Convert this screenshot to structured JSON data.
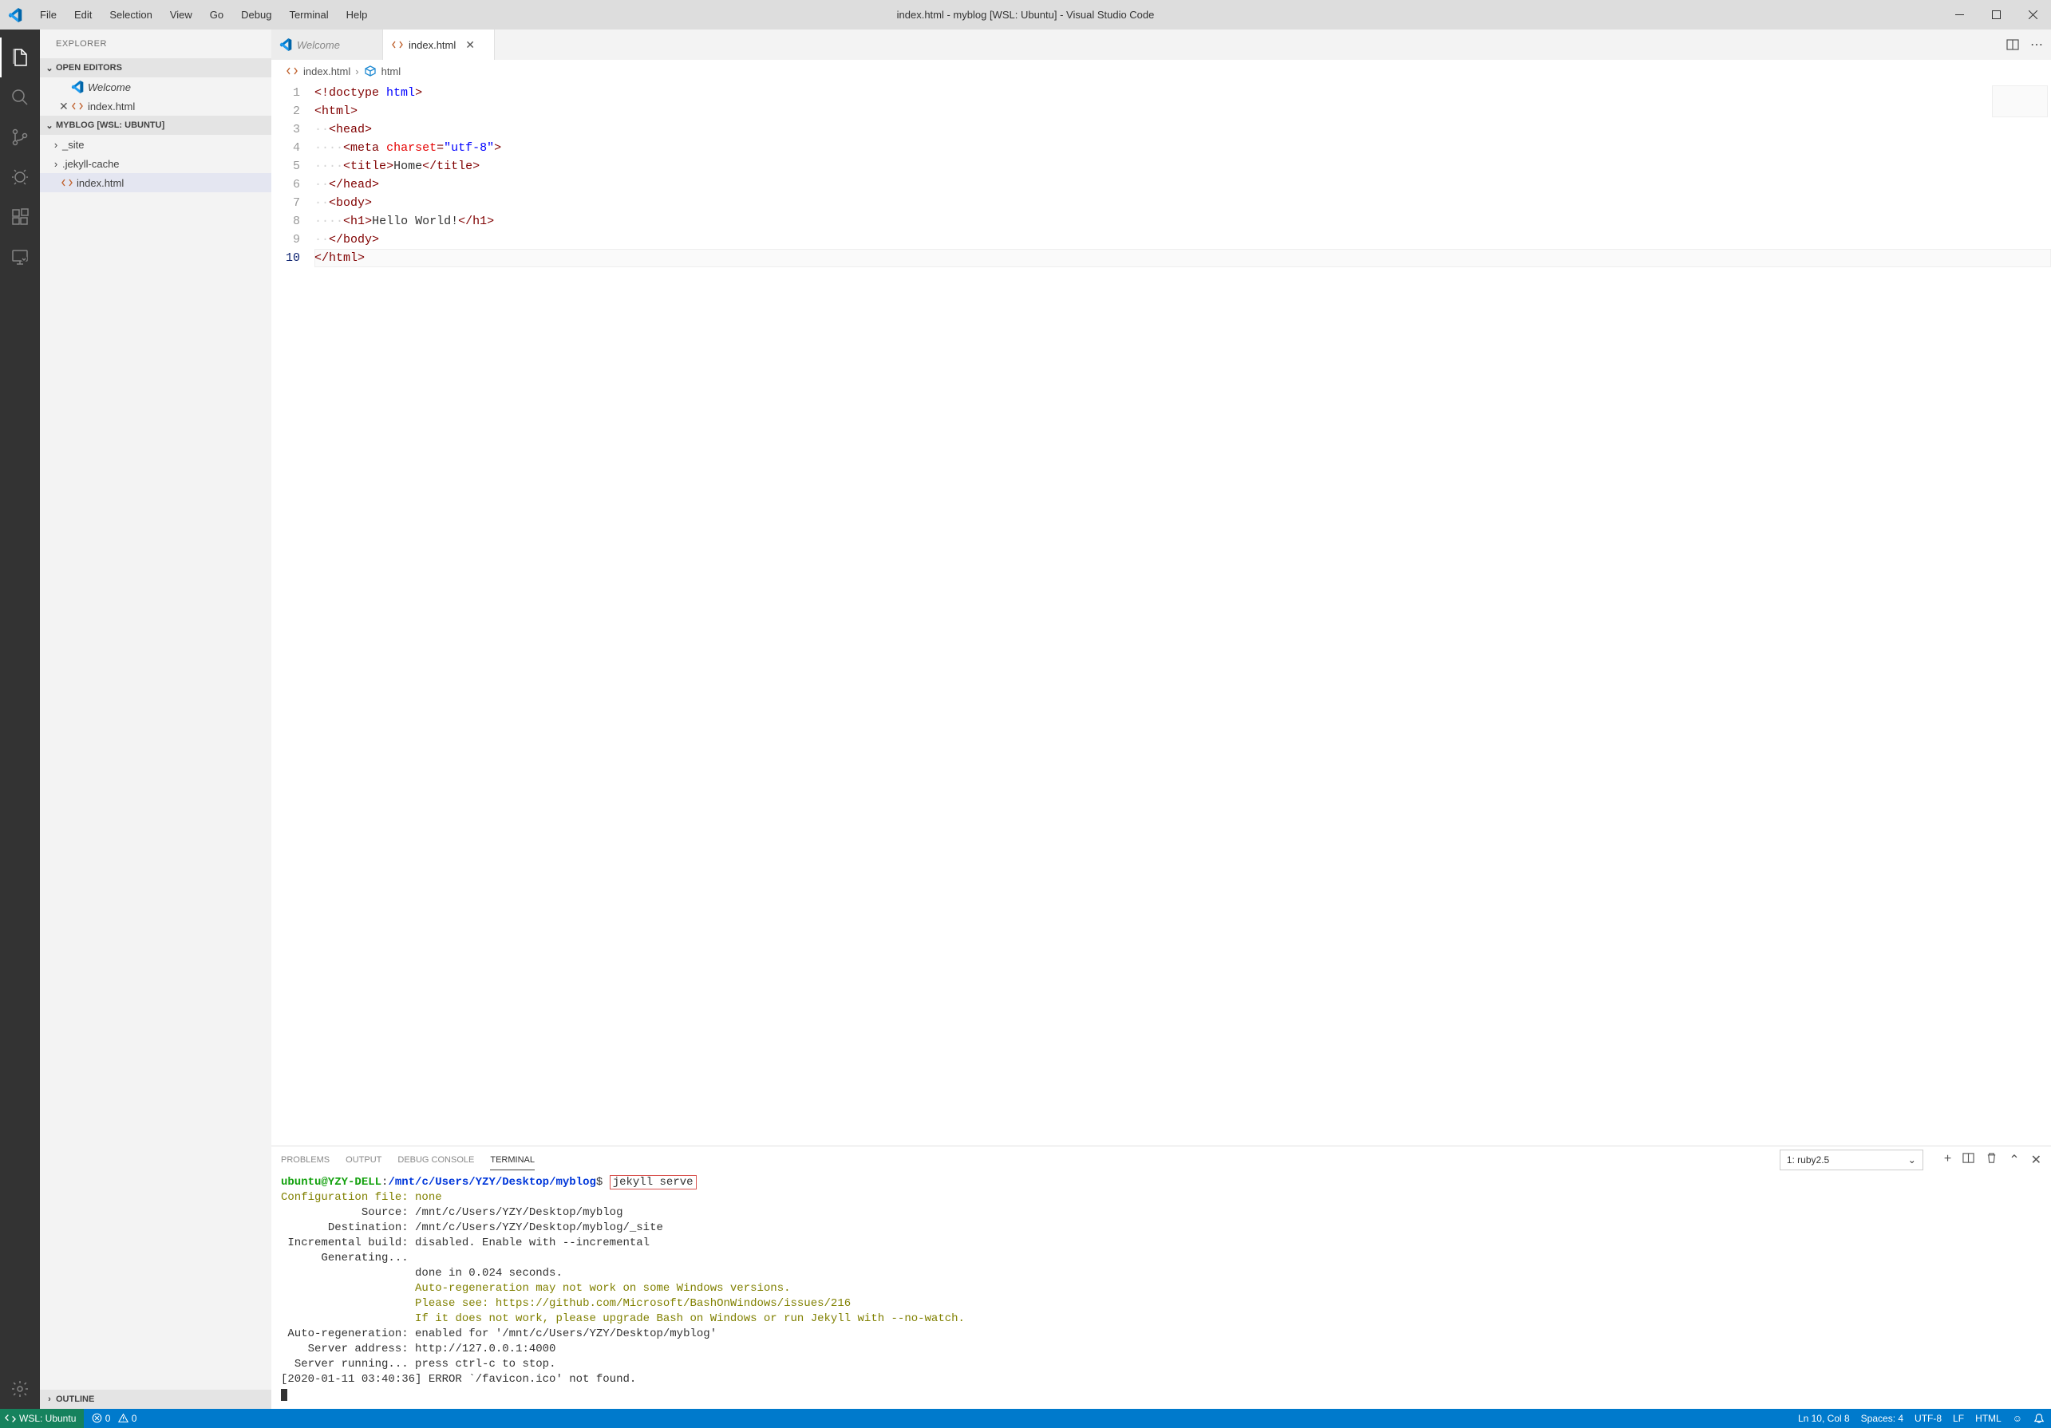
{
  "window": {
    "title": "index.html - myblog [WSL: Ubuntu] - Visual Studio Code"
  },
  "menu": [
    "File",
    "Edit",
    "Selection",
    "View",
    "Go",
    "Debug",
    "Terminal",
    "Help"
  ],
  "activity": {
    "items": [
      "explorer",
      "search",
      "scm",
      "debug",
      "extensions",
      "remote"
    ],
    "bottom": "settings"
  },
  "sidebar": {
    "header": "EXPLORER",
    "open_editors_label": "OPEN EDITORS",
    "open_editors": [
      {
        "label": "Welcome",
        "icon": "vscode",
        "italic": true,
        "closable": false
      },
      {
        "label": "index.html",
        "icon": "html",
        "italic": false,
        "closable": true
      }
    ],
    "project_label": "MYBLOG [WSL: UBUNTU]",
    "tree": [
      {
        "label": "_site",
        "type": "folder"
      },
      {
        "label": ".jekyll-cache",
        "type": "folder"
      },
      {
        "label": "index.html",
        "type": "file",
        "selected": true
      }
    ],
    "outline_label": "OUTLINE"
  },
  "tabs": {
    "items": [
      {
        "label": "Welcome",
        "icon": "vscode",
        "italic": true,
        "closable": false,
        "active": false
      },
      {
        "label": "index.html",
        "icon": "html",
        "italic": false,
        "closable": true,
        "active": true
      }
    ]
  },
  "breadcrumbs": {
    "file": "index.html",
    "symbol": "html"
  },
  "editor": {
    "lines": [
      {
        "n": 1,
        "segments": [
          {
            "c": "tok-punct",
            "t": "<!"
          },
          {
            "c": "tok-decl",
            "t": "doctype"
          },
          {
            "c": "",
            "t": " "
          },
          {
            "c": "tok-name",
            "t": "html"
          },
          {
            "c": "tok-punct",
            "t": ">"
          }
        ],
        "indent": 0
      },
      {
        "n": 2,
        "segments": [
          {
            "c": "tok-punct",
            "t": "<"
          },
          {
            "c": "tok-tag",
            "t": "html"
          },
          {
            "c": "tok-punct",
            "t": ">"
          }
        ],
        "indent": 0
      },
      {
        "n": 3,
        "segments": [
          {
            "c": "tok-punct",
            "t": "<"
          },
          {
            "c": "tok-tag",
            "t": "head"
          },
          {
            "c": "tok-punct",
            "t": ">"
          }
        ],
        "indent": 1
      },
      {
        "n": 4,
        "segments": [
          {
            "c": "tok-punct",
            "t": "<"
          },
          {
            "c": "tok-tag",
            "t": "meta"
          },
          {
            "c": "",
            "t": " "
          },
          {
            "c": "tok-attr",
            "t": "charset"
          },
          {
            "c": "tok-punct",
            "t": "="
          },
          {
            "c": "tok-str",
            "t": "\"utf-8\""
          },
          {
            "c": "tok-punct",
            "t": ">"
          }
        ],
        "indent": 2
      },
      {
        "n": 5,
        "segments": [
          {
            "c": "tok-punct",
            "t": "<"
          },
          {
            "c": "tok-tag",
            "t": "title"
          },
          {
            "c": "tok-punct",
            "t": ">"
          },
          {
            "c": "tok-text",
            "t": "Home"
          },
          {
            "c": "tok-punct",
            "t": "</"
          },
          {
            "c": "tok-tag",
            "t": "title"
          },
          {
            "c": "tok-punct",
            "t": ">"
          }
        ],
        "indent": 2
      },
      {
        "n": 6,
        "segments": [
          {
            "c": "tok-punct",
            "t": "</"
          },
          {
            "c": "tok-tag",
            "t": "head"
          },
          {
            "c": "tok-punct",
            "t": ">"
          }
        ],
        "indent": 1
      },
      {
        "n": 7,
        "segments": [
          {
            "c": "tok-punct",
            "t": "<"
          },
          {
            "c": "tok-tag",
            "t": "body"
          },
          {
            "c": "tok-punct",
            "t": ">"
          }
        ],
        "indent": 1
      },
      {
        "n": 8,
        "segments": [
          {
            "c": "tok-punct",
            "t": "<"
          },
          {
            "c": "tok-tag",
            "t": "h1"
          },
          {
            "c": "tok-punct",
            "t": ">"
          },
          {
            "c": "tok-text",
            "t": "Hello World!"
          },
          {
            "c": "tok-punct",
            "t": "</"
          },
          {
            "c": "tok-tag",
            "t": "h1"
          },
          {
            "c": "tok-punct",
            "t": ">"
          }
        ],
        "indent": 2
      },
      {
        "n": 9,
        "segments": [
          {
            "c": "tok-punct",
            "t": "</"
          },
          {
            "c": "tok-tag",
            "t": "body"
          },
          {
            "c": "tok-punct",
            "t": ">"
          }
        ],
        "indent": 1
      },
      {
        "n": 10,
        "segments": [
          {
            "c": "tok-punct",
            "t": "</"
          },
          {
            "c": "tok-tag",
            "t": "html"
          },
          {
            "c": "tok-punct",
            "t": ">"
          }
        ],
        "indent": 0,
        "current": true
      }
    ]
  },
  "panel": {
    "tabs": [
      "PROBLEMS",
      "OUTPUT",
      "DEBUG CONSOLE",
      "TERMINAL"
    ],
    "active_tab": "TERMINAL",
    "terminal_name": "1: ruby2.5"
  },
  "terminal": {
    "user": "ubuntu@YZY-DELL",
    "path": "/mnt/c/Users/YZY/Desktop/myblog",
    "prompt_sep": ":",
    "prompt_end": "$",
    "command": "jekyll serve",
    "lines": [
      {
        "cls": "term-olive",
        "t": "Configuration file: none"
      },
      {
        "cls": "",
        "t": "            Source: /mnt/c/Users/YZY/Desktop/myblog"
      },
      {
        "cls": "",
        "t": "       Destination: /mnt/c/Users/YZY/Desktop/myblog/_site"
      },
      {
        "cls": "",
        "t": " Incremental build: disabled. Enable with --incremental"
      },
      {
        "cls": "",
        "t": "      Generating..."
      },
      {
        "cls": "",
        "t": "                    done in 0.024 seconds."
      },
      {
        "cls": "term-olive",
        "t": "                    Auto-regeneration may not work on some Windows versions."
      },
      {
        "cls": "term-olive",
        "t": "                    Please see: https://github.com/Microsoft/BashOnWindows/issues/216"
      },
      {
        "cls": "term-olive",
        "t": "                    If it does not work, please upgrade Bash on Windows or run Jekyll with --no-watch."
      },
      {
        "cls": "",
        "t": " Auto-regeneration: enabled for '/mnt/c/Users/YZY/Desktop/myblog'"
      },
      {
        "cls": "",
        "t": "    Server address: http://127.0.0.1:4000"
      },
      {
        "cls": "",
        "t": "  Server running... press ctrl-c to stop."
      },
      {
        "cls": "",
        "t": "[2020-01-11 03:40:36] ERROR `/favicon.ico' not found."
      }
    ]
  },
  "status": {
    "remote": "WSL: Ubuntu",
    "errors": "0",
    "warnings": "0",
    "cursor": "Ln 10, Col 8",
    "spaces": "Spaces: 4",
    "encoding": "UTF-8",
    "eol": "LF",
    "language": "HTML"
  }
}
